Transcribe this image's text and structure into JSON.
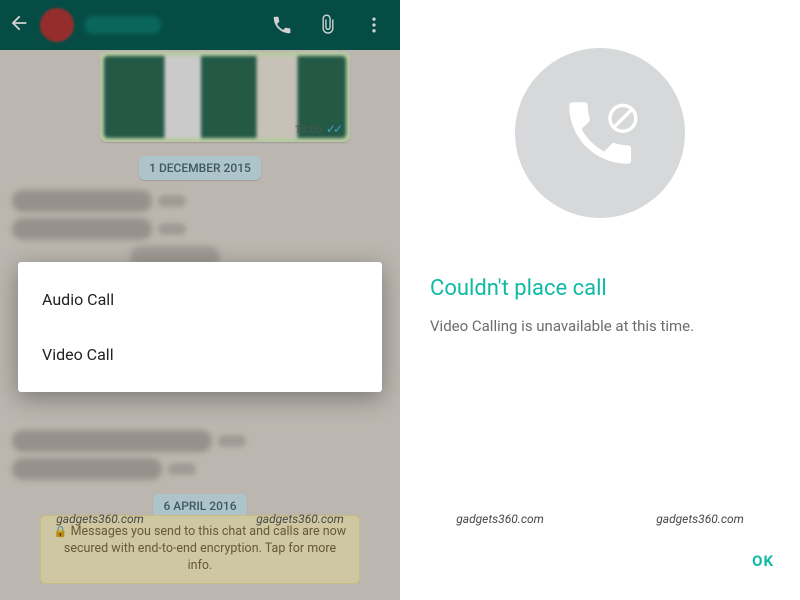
{
  "left": {
    "header": {
      "contact_name": "(redacted)"
    },
    "image_bubble": {
      "time": "18:06"
    },
    "date_chips": [
      "1 DECEMBER 2015",
      "6 APRIL 2016"
    ],
    "encryption_banner": "Messages you send to this chat and calls are now secured with end-to-end encryption. Tap for more info.",
    "dialog": {
      "options": [
        "Audio Call",
        "Video Call"
      ]
    }
  },
  "right": {
    "title": "Couldn't place call",
    "body": "Video Calling is unavailable at this time.",
    "ok": "OK"
  },
  "watermark": "gadgets360.com",
  "colors": {
    "wa_teal": "#075e54",
    "accent": "#0fbaa5"
  }
}
